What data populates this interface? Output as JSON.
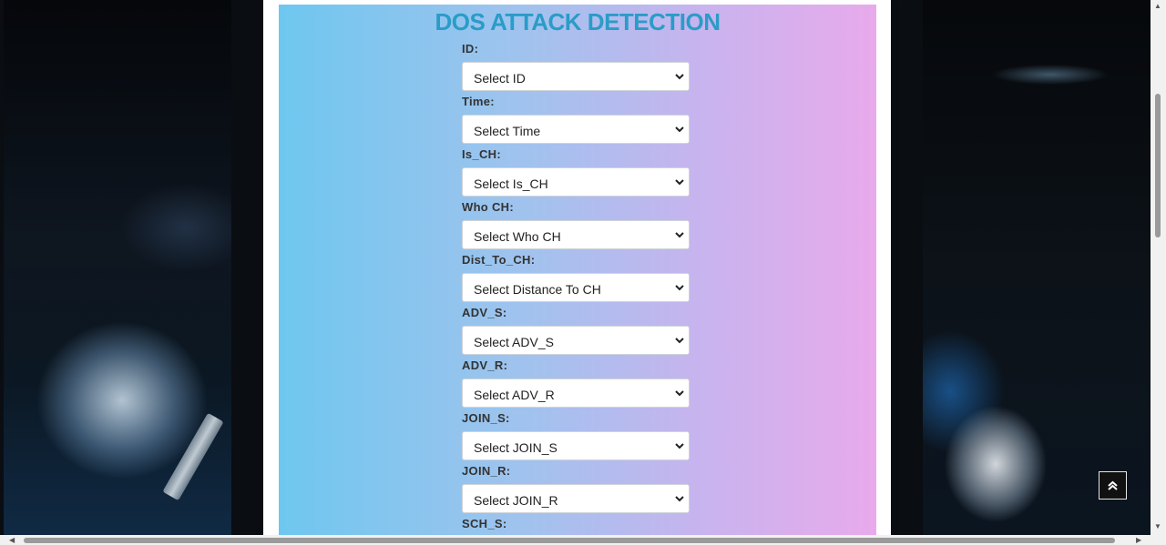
{
  "app": {
    "title": "DOS ATTACK DETECTION"
  },
  "form": {
    "fields": [
      {
        "label": "ID:",
        "placeholder": "Select ID"
      },
      {
        "label": "Time:",
        "placeholder": "Select Time"
      },
      {
        "label": "Is_CH:",
        "placeholder": "Select Is_CH"
      },
      {
        "label": "Who CH:",
        "placeholder": "Select Who CH"
      },
      {
        "label": "Dist_To_CH:",
        "placeholder": "Select Distance To CH"
      },
      {
        "label": "ADV_S:",
        "placeholder": "Select ADV_S"
      },
      {
        "label": "ADV_R:",
        "placeholder": "Select ADV_R"
      },
      {
        "label": "JOIN_S:",
        "placeholder": "Select JOIN_S"
      },
      {
        "label": "JOIN_R:",
        "placeholder": "Select JOIN_R"
      },
      {
        "label": "SCH_S:"
      }
    ]
  },
  "icons": {
    "select_arrow": "chevron-down-icon",
    "back_to_top": "double-chevron-up-icon"
  },
  "colors": {
    "title": "#2a9cc8",
    "panel_gradient_start": "#6ec7ef",
    "panel_gradient_end": "#e8aaeb",
    "back_to_top_bg": "#111111"
  }
}
